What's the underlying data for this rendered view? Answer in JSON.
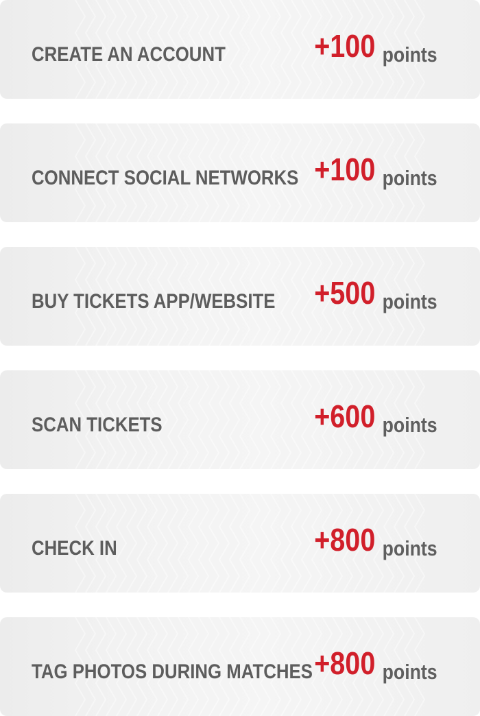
{
  "rewards": [
    {
      "action": "CREATE AN ACCOUNT",
      "points": "+100",
      "unit": "points"
    },
    {
      "action": "CONNECT SOCIAL NETWORKS",
      "points": "+100",
      "unit": "points"
    },
    {
      "action": "BUY TICKETS APP/WEBSITE",
      "points": "+500",
      "unit": "points"
    },
    {
      "action": "SCAN TICKETS",
      "points": "+600",
      "unit": "points"
    },
    {
      "action": "CHECK IN",
      "points": "+800",
      "unit": "points"
    },
    {
      "action": "TAG PHOTOS DURING MATCHES",
      "points": "+800",
      "unit": "points"
    }
  ],
  "colors": {
    "accent": "#d11f2a",
    "text": "#5d5d5d",
    "card_background": "#f2f2f2"
  }
}
